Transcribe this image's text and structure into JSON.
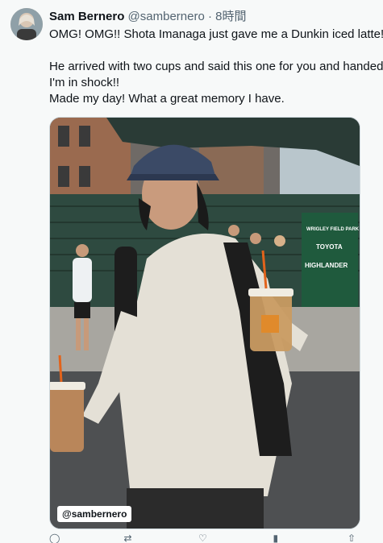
{
  "tweet": {
    "display_name": "Sam Bernero",
    "handle": "@sambernero",
    "separator": " · ",
    "time": "8時間",
    "lines": [
      "OMG! OMG!!  Shota Imanaga just gave me a Dunkin iced latte!",
      "He arrived with two cups and said this one for you and handed",
      "I'm in shock!!",
      "Made my day! What a great memory I have."
    ]
  },
  "media": {
    "watermark": "@sambernero",
    "stadium_sign": {
      "line1": "WRIGLEY FIELD PARK",
      "line2": "TOYOTA",
      "line3": "HIGHLANDER"
    }
  },
  "actions": {
    "icons": [
      "reply-icon",
      "retweet-icon",
      "like-icon",
      "views-icon",
      "share-icon"
    ]
  },
  "colors": {
    "background": "#f7f9f9",
    "text": "#0f1419",
    "secondary_text": "#536471",
    "sign_green": "#1f5a3d"
  }
}
